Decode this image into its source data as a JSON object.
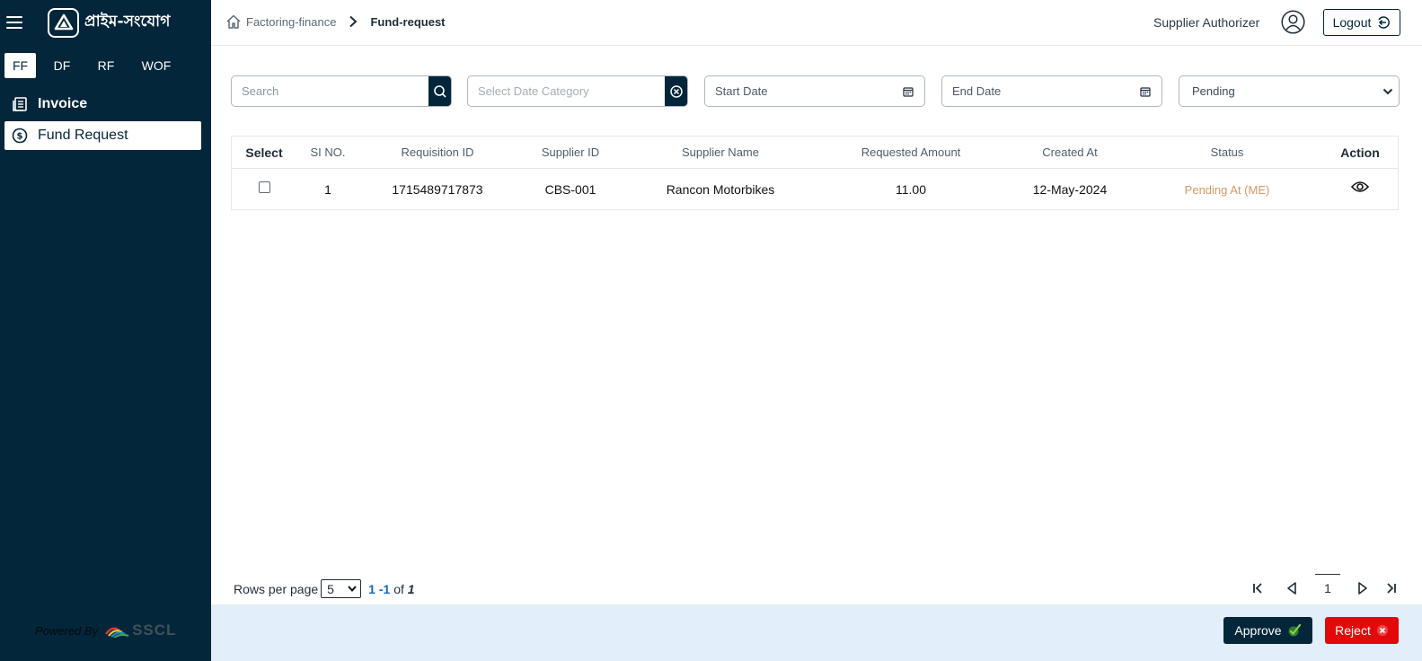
{
  "brand": {
    "name": "প্রাইম-সংযোগ"
  },
  "sidebar": {
    "module_tabs": [
      {
        "label": "FF",
        "active": true
      },
      {
        "label": "DF"
      },
      {
        "label": "RF"
      },
      {
        "label": "WOF"
      }
    ],
    "items": [
      {
        "label": "Invoice",
        "icon": "invoice-icon"
      },
      {
        "label": "Fund Request",
        "icon": "dollar-icon",
        "active": true
      }
    ],
    "powered_by": "Powered By",
    "powered_logo_text": "SSCL"
  },
  "header": {
    "breadcrumb": [
      "Factoring-finance",
      "Fund-request"
    ],
    "user_role": "Supplier Authorizer",
    "logout_label": "Logout"
  },
  "filters": {
    "search_placeholder": "Search",
    "date_category_placeholder": "Select Date Category",
    "start_date_placeholder": "Start Date",
    "end_date_placeholder": "End Date",
    "status_value": "Pending"
  },
  "table": {
    "columns": [
      "Select",
      "SI NO.",
      "Requisition ID",
      "Supplier ID",
      "Supplier Name",
      "Requested Amount",
      "Created At",
      "Status",
      "Action"
    ],
    "rows": [
      {
        "si_no": "1",
        "requisition_id": "1715489717873",
        "supplier_id": "CBS-001",
        "supplier_name": "Rancon Motorbikes",
        "requested_amount": "11.00",
        "created_at": "12-May-2024",
        "status": "Pending At (ME)",
        "checked": false
      }
    ],
    "status_color": "#d39867"
  },
  "pagination": {
    "rows_per_page_label": "Rows per page",
    "rows_per_page": "5",
    "range_start": "1",
    "range_sep": "-",
    "range_end": "1",
    "of_label": "of",
    "total": "1",
    "current_page": "1"
  },
  "actions": {
    "approve_label": "Approve",
    "reject_label": "Reject"
  },
  "colors": {
    "sidebar_bg": "#04263a",
    "action_bar_bg": "#e3eefb",
    "reject_bg": "#e4080a",
    "link_blue": "#1565c0"
  }
}
